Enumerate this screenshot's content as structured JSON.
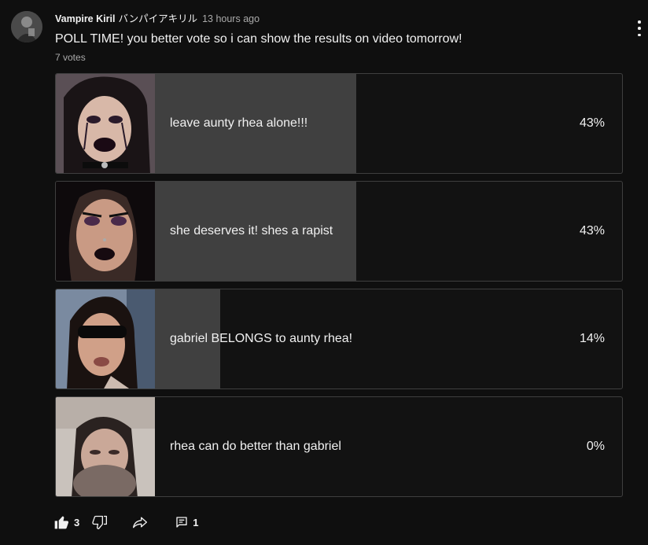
{
  "post": {
    "author": "Vampire Kiril",
    "author_jp": "バンパイアキリル",
    "time": "13 hours ago",
    "text": "POLL TIME! you better vote so i can show the results on video tomorrow!",
    "votes": "7 votes"
  },
  "poll": {
    "options": [
      {
        "label": "leave aunty rhea alone!!!",
        "percent_text": "43%",
        "percent": 43
      },
      {
        "label": "she deserves it! shes a rapist",
        "percent_text": "43%",
        "percent": 43
      },
      {
        "label": "gabriel BELONGS to aunty rhea!",
        "percent_text": "14%",
        "percent": 14
      },
      {
        "label": "rhea can do better than gabriel",
        "percent_text": "0%",
        "percent": 0
      }
    ]
  },
  "actions": {
    "likes": "3",
    "comments": "1"
  },
  "colors": {
    "background": "#0f0f0f",
    "fill": "#404040",
    "border": "#3f3f3f",
    "text": "#f1f1f1",
    "muted": "#aaaaaa"
  },
  "icons": {
    "avatar": "avatar",
    "menu": "more-vert-icon",
    "like": "thumbs-up-icon",
    "dislike": "thumbs-down-icon",
    "share": "share-icon",
    "comment": "comment-icon"
  }
}
